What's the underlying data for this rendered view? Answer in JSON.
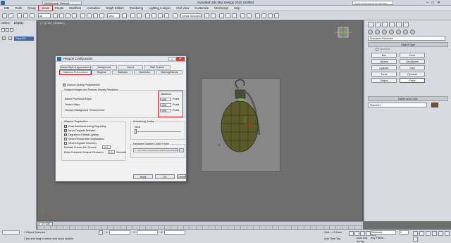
{
  "titlebar": {
    "workspace": "Workspace: Default",
    "app_title": "Autodesk 3ds Max Design 2015    Untitled",
    "search_placeholder": "Type a keyword or phrase",
    "window_buttons": [
      "–",
      "▭",
      "✕"
    ]
  },
  "menubar": {
    "items": [
      "Edit",
      "Tools",
      "Group",
      "Views",
      "Create",
      "Modifiers",
      "Animation",
      "Graph Editors",
      "Rendering",
      "Lighting Analysis",
      "Civil View",
      "Customize",
      "MAXScript",
      "Help"
    ],
    "highlighted_index": 3
  },
  "toolbar": {
    "filter_value": "All",
    "view_value": "View",
    "named_sel_value": "Create Selection Se"
  },
  "scene_explorer": {
    "tabs": [
      "Select",
      "Display"
    ],
    "selected_item": "Plane001"
  },
  "viewport": {
    "label": "[ + ] [ Left ] [ Shaded ]"
  },
  "command_panel": {
    "dropdown": "Standard Primitives",
    "object_type_header": "Object Type",
    "autogrid_label": "AutoGrid",
    "object_buttons": [
      "Box",
      "Cone",
      "Sphere",
      "GeoSphere",
      "Cylinder",
      "Tube",
      "Torus",
      "Pyramid",
      "Teapot",
      "Plane"
    ],
    "name_color_header": "Name and Color",
    "name_value": "Plane001"
  },
  "timeline": {
    "slider_label": "0 / 100"
  },
  "dialog": {
    "title": "Viewport Configuration",
    "help": "?",
    "close": "✕",
    "tabs_row1": [
      "Visual Style & Appearance",
      "Background",
      "Layout",
      "Safe Frames"
    ],
    "tabs_row2": [
      "Stateless Performance",
      "Regions",
      "Statistics",
      "ViewCube",
      "SteeringWheels"
    ],
    "improve_quality_label": "Improve Quality Progressively",
    "images_group_label": "Viewport Images and Textures Display Resolution",
    "baked_label": "Baked Procedural Maps:",
    "texture_label": "Texture Maps:",
    "background_label": "Viewport Background / Environment:",
    "maximum_label": "Maximum:",
    "baked_value": "4096",
    "texture_value": "4096",
    "background_value": "4096",
    "pixels": "Pixels",
    "adaptive_group_label": "Adaptive Degradation",
    "adaptive_options": [
      "Draw Backfaces during Degrading",
      "Never Degrade Selected",
      "Degrade to Default Lighting",
      "Never Redraw After Degradation",
      "Never Degrade Geometry"
    ],
    "adaptive_checked": [
      true,
      true,
      true,
      false,
      false
    ],
    "maintain_fps_label": "Maintain Frames Per Second:",
    "maintain_fps_value": "20.0",
    "delay_label": "Delay Complete Viewport Redraw in",
    "delay_value": "1.0",
    "seconds": "Seconds",
    "aa_group_label": "Antialiasing Quality",
    "aa_value": "None",
    "cache_group_label": "Hardware Shaders Cache Folder",
    "cache_path": "C:\\Users\\Mevo\\AppData\\Local\\Autodesk\\3dsM",
    "browse": "...",
    "apply": "Apply",
    "ok": "OK",
    "cancel": "Cancel"
  },
  "status": {
    "selection": "1 Object Selected",
    "prompt": "Click and drag to select and move objects",
    "x_label": "X:",
    "y_label": "Y:",
    "z_label": "Z:",
    "x_value": "",
    "y_value": "",
    "z_value": "",
    "grid": "Grid = 10.0mm",
    "add_time_tag": "Add Time Tag",
    "auto_key": "Auto Key",
    "set_key": "Set Key",
    "auto_key_value": "Selected",
    "key_filters": "Key Filters...",
    "frame": "0"
  },
  "colors": {
    "highlight_red": "#e0202a",
    "grenade_body": "#5b5a2a",
    "color_swatch": "#7e4f1f"
  }
}
